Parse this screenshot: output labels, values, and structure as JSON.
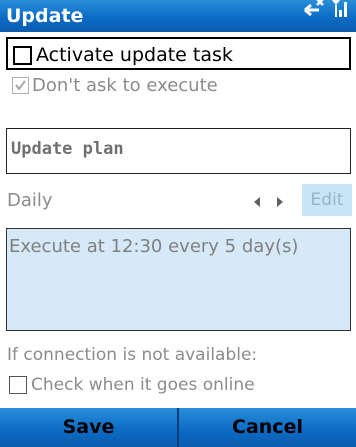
{
  "window": {
    "title": "Update"
  },
  "activate_task": {
    "label": "Activate update task",
    "checked": false
  },
  "dont_ask": {
    "label": "Don't ask to execute",
    "checked": true,
    "enabled": false
  },
  "plan_field": {
    "value": "Update plan"
  },
  "schedule": {
    "frequency": "Daily",
    "edit_label": "Edit"
  },
  "plan_description": {
    "text": "Execute at 12:30 every 5 day(s)"
  },
  "connection": {
    "note": "If connection is not available:",
    "online_check": {
      "label": "Check when it goes online",
      "checked": false
    }
  },
  "softkeys": {
    "save": "Save",
    "cancel": "Cancel"
  },
  "colors": {
    "titlebar": "#0d6cc6",
    "panel": "#d5e9f8",
    "edit_button": "#c9e3f7",
    "disabled_text": "#808080"
  },
  "icons": [
    "connectivity-icon",
    "signal-icon",
    "prev-arrow-icon",
    "next-arrow-icon",
    "checkmark-icon"
  ]
}
